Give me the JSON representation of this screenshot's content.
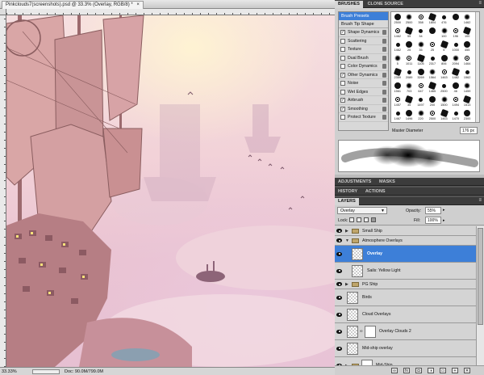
{
  "document": {
    "tab_title": "Pinkclouds7(screenshots).psd @ 33.3% (Overlay, RGB/8) *",
    "close_glyph": "×",
    "status": {
      "zoom": "33.33%",
      "doc_size": "Doc: 90.0M/799.0M"
    }
  },
  "brushes_panel": {
    "tabs": [
      "BRUSHES",
      "CLONE SOURCE"
    ],
    "menu_glyph": "≡",
    "presets_label": "Brush Presets",
    "tip_shape_label": "Brush Tip Shape",
    "options": [
      {
        "label": "Shape Dynamics",
        "checked": true
      },
      {
        "label": "Scattering",
        "checked": false
      },
      {
        "label": "Texture",
        "checked": false
      },
      {
        "label": "Dual Brush",
        "checked": false
      },
      {
        "label": "Color Dynamics",
        "checked": false
      },
      {
        "label": "Other Dynamics",
        "checked": true
      },
      {
        "label": "Noise",
        "checked": false
      },
      {
        "label": "Wet Edges",
        "checked": false
      },
      {
        "label": "Airbrush",
        "checked": true
      },
      {
        "label": "Smoothing",
        "checked": true
      },
      {
        "label": "Protect Texture",
        "checked": false
      }
    ],
    "brush_sizes": [
      "2500",
      "2500",
      "358",
      "1804",
      "476",
      "",
      "1462",
      "1462",
      "55",
      "34",
      "",
      "100",
      "196",
      "100",
      "1462",
      "25",
      "35",
      "25",
      "5",
      "1000",
      "455",
      "5",
      "1011",
      "1105",
      "2317",
      "806",
      "2094",
      "1464",
      "2359",
      "2089",
      "3269",
      "1564",
      "1463",
      "1482",
      "1562",
      "1561",
      "703",
      "647",
      "1465",
      "2500",
      "46",
      "1459",
      "1457",
      "35",
      "1497",
      "200",
      "1500",
      "1494",
      "1513",
      "1467",
      "1496",
      "220",
      "2500",
      "1463",
      "1470",
      "2300",
      "2500"
    ],
    "master_diameter_label": "Master Diameter",
    "master_diameter_value": "176 px"
  },
  "collapsed_panels": {
    "adjustments_tabs": [
      "ADJUSTMENTS",
      "MASKS"
    ],
    "history_tabs": [
      "HISTORY",
      "ACTIONS"
    ]
  },
  "layers_panel": {
    "tab": "LAYERS",
    "blend_mode": "Overlay",
    "opacity_label": "Opacity:",
    "opacity_value": "55%",
    "lock_label": "Lock:",
    "fill_label": "Fill:",
    "fill_value": "100%",
    "layers": [
      {
        "name": "Small Ship",
        "kind": "group",
        "indent": 0,
        "selected": false
      },
      {
        "name": "Atmosphere Overlays",
        "kind": "group-open",
        "indent": 0,
        "selected": false
      },
      {
        "name": "Overlay",
        "kind": "layer",
        "indent": 1,
        "selected": true
      },
      {
        "name": "Sails: Yellow Light",
        "kind": "layer",
        "indent": 1,
        "selected": false
      },
      {
        "name": "PG Ship",
        "kind": "group",
        "indent": 0,
        "selected": false
      },
      {
        "name": "Birds",
        "kind": "layer",
        "indent": 0,
        "selected": false
      },
      {
        "name": "Cloud Overlays",
        "kind": "layer",
        "indent": 0,
        "selected": false
      },
      {
        "name": "Overlay Clouds 2",
        "kind": "masked",
        "indent": 0,
        "selected": false
      },
      {
        "name": "Mid-ship overlay",
        "kind": "layer",
        "indent": 0,
        "selected": false
      },
      {
        "name": "Mid-Ship",
        "kind": "group-masked",
        "indent": 0,
        "selected": false
      }
    ],
    "footer_icons": [
      "link-icon",
      "fx-icon",
      "mask-icon",
      "adjustment-icon",
      "group-icon",
      "new-layer-icon",
      "trash-icon"
    ]
  }
}
